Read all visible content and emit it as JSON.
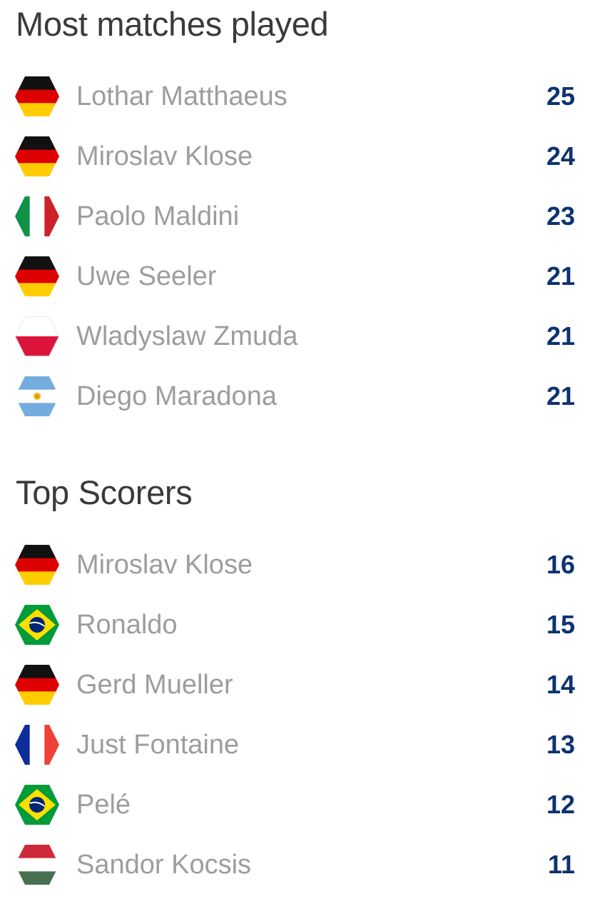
{
  "sections": [
    {
      "title": "Most matches played",
      "rows": [
        {
          "flag": "germany-flag-icon",
          "name": "Lothar Matthaeus",
          "value": "25"
        },
        {
          "flag": "germany-flag-icon",
          "name": "Miroslav Klose",
          "value": "24"
        },
        {
          "flag": "italy-flag-icon",
          "name": "Paolo Maldini",
          "value": "23"
        },
        {
          "flag": "germany-flag-icon",
          "name": "Uwe Seeler",
          "value": "21"
        },
        {
          "flag": "poland-flag-icon",
          "name": "Wladyslaw Zmuda",
          "value": "21"
        },
        {
          "flag": "argentina-flag-icon",
          "name": "Diego Maradona",
          "value": "21"
        }
      ]
    },
    {
      "title": "Top Scorers",
      "rows": [
        {
          "flag": "germany-flag-icon",
          "name": "Miroslav Klose",
          "value": "16"
        },
        {
          "flag": "brazil-flag-icon",
          "name": "Ronaldo",
          "value": "15"
        },
        {
          "flag": "germany-flag-icon",
          "name": "Gerd Mueller",
          "value": "14"
        },
        {
          "flag": "france-flag-icon",
          "name": "Just Fontaine",
          "value": "13"
        },
        {
          "flag": "brazil-flag-icon",
          "name": "Pelé",
          "value": "12"
        },
        {
          "flag": "hungary-flag-icon",
          "name": "Sandor Kocsis",
          "value": "11"
        }
      ]
    }
  ],
  "colors": {
    "title": "#3a3a3a",
    "name": "#9d9d9d",
    "value": "#0d3370"
  }
}
